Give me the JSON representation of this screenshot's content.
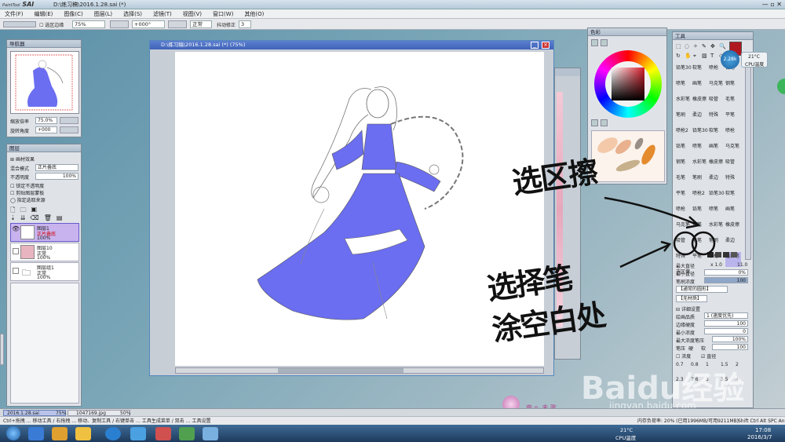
{
  "app": {
    "logo_small": "PaintTool",
    "logo_big": "SAI",
    "title": "D:\\练习稿\\2016.1.28.sai (*)"
  },
  "menu": [
    "文件(F)",
    "编辑(E)",
    "图像(C)",
    "图层(L)",
    "选择(S)",
    "滤镜(T)",
    "视图(V)",
    "窗口(W)",
    "其他(O)"
  ],
  "toolbar": {
    "selection_edge_label": "选区边缘",
    "zoom": "75%",
    "rotation": "+000°",
    "blend": "正常",
    "stabilizer_label": "抖动修正",
    "stabilizer_value": "3"
  },
  "navigator": {
    "title": "导航器",
    "zoom_label": "缩放倍率",
    "zoom_value": "75.0%",
    "angle_label": "旋转角度",
    "angle_value": "+000"
  },
  "layers_panel": {
    "title": "图层",
    "texture_label": "画材效果",
    "mode_label": "混合模式",
    "mode_value": "正片叠底",
    "opacity_label": "不透明度",
    "opacity_value": "100%",
    "checks": [
      "锁定不透明度",
      "剪贴图层蒙板",
      "指定选取来源"
    ],
    "layers": [
      {
        "name": "图层1",
        "mode": "正片叠底",
        "opacity": "100%",
        "selected": true
      },
      {
        "name": "图层10",
        "mode": "正常",
        "opacity": "100%",
        "selected": false
      },
      {
        "name": "图层组1",
        "mode": "正常",
        "opacity": "100%",
        "selected": false
      }
    ]
  },
  "document": {
    "title": "D:\\练习稿\\2016.1.28.sai (*) (75%)"
  },
  "color_panel": {
    "title": "色彩"
  },
  "tools_panel": {
    "title": "工具",
    "brush_names": [
      "铅笔30",
      "软笔",
      "喷枪",
      "铅笔",
      "喷笔",
      "画笔",
      "马克笔",
      "钢笔",
      "水彩笔",
      "橡皮擦",
      "吸管",
      "毛笔",
      "笔刷",
      "柔边",
      "特殊",
      "平笔",
      "喷枪2",
      "选择笔",
      "选区擦"
    ],
    "max_diameter_label": "最大直径",
    "max_diameter_mult": "x 1.0",
    "max_diameter_value": "11.0",
    "min_diameter_label": "最小直径",
    "min_diameter_value": "0%",
    "density_label": "笔刷浓度",
    "density_value": "100",
    "shape_value": "【通常的圆形】",
    "texture_value": "【无材质】",
    "detail_label": "详细设置",
    "quality_label": "绘画品质",
    "quality_value": "1 (速度优先)",
    "edge_label": "边缘硬度",
    "edge_value": "100",
    "min_density_label": "最小浓度",
    "min_density_value": "0",
    "max_pressure_label": "最大浓度笔压",
    "max_pressure_value": "100%",
    "pressure_label": "笔压",
    "pressure_hard": "硬",
    "pressure_soft": "软",
    "pressure_value": "100",
    "pressure_opts": [
      "浓度",
      "直径"
    ],
    "size_presets": [
      "0.7",
      "0.8",
      "1",
      "1.5",
      "2",
      "2.3",
      "2.6",
      "3",
      "3.5",
      "4"
    ]
  },
  "temperature": {
    "value": "21°C",
    "label": "CPU温度",
    "badge": "2.28k"
  },
  "annotations": {
    "select_eraser": "选区擦",
    "select_pen": "选择笔",
    "paint_line1": "选择笔",
    "paint_line2": "涂空白处"
  },
  "file_tabs": [
    {
      "name": "2016.1.28.sai",
      "zoom": "75%"
    },
    {
      "name": "1047169.jpg",
      "zoom": "50%"
    }
  ],
  "statusbar": {
    "hints": "Ctrl+拖拽 … 移动工具 / 右拖拽 … 移动、复制工具 / 右键单击 … 工具生成菜单 / 双击 … 工具设置",
    "memory": "内存负荷率: 20% (已用1996MB/可用9211MB)",
    "keys": "Shift Ctrl Alt SPC Any"
  },
  "watermark": {
    "caption": "申 o. 未 歌",
    "brand": "Baidu经验",
    "url": "jingyan.baidu.com"
  },
  "taskbar": {
    "time": "17:08",
    "date": "2016/3/7",
    "temp": "21°C",
    "temp_label": "CPU温度"
  },
  "colors": {
    "fill_blue": "#6b6ef0",
    "accent_red": "#b01820",
    "doc_title_blue": "#3f63b8"
  }
}
